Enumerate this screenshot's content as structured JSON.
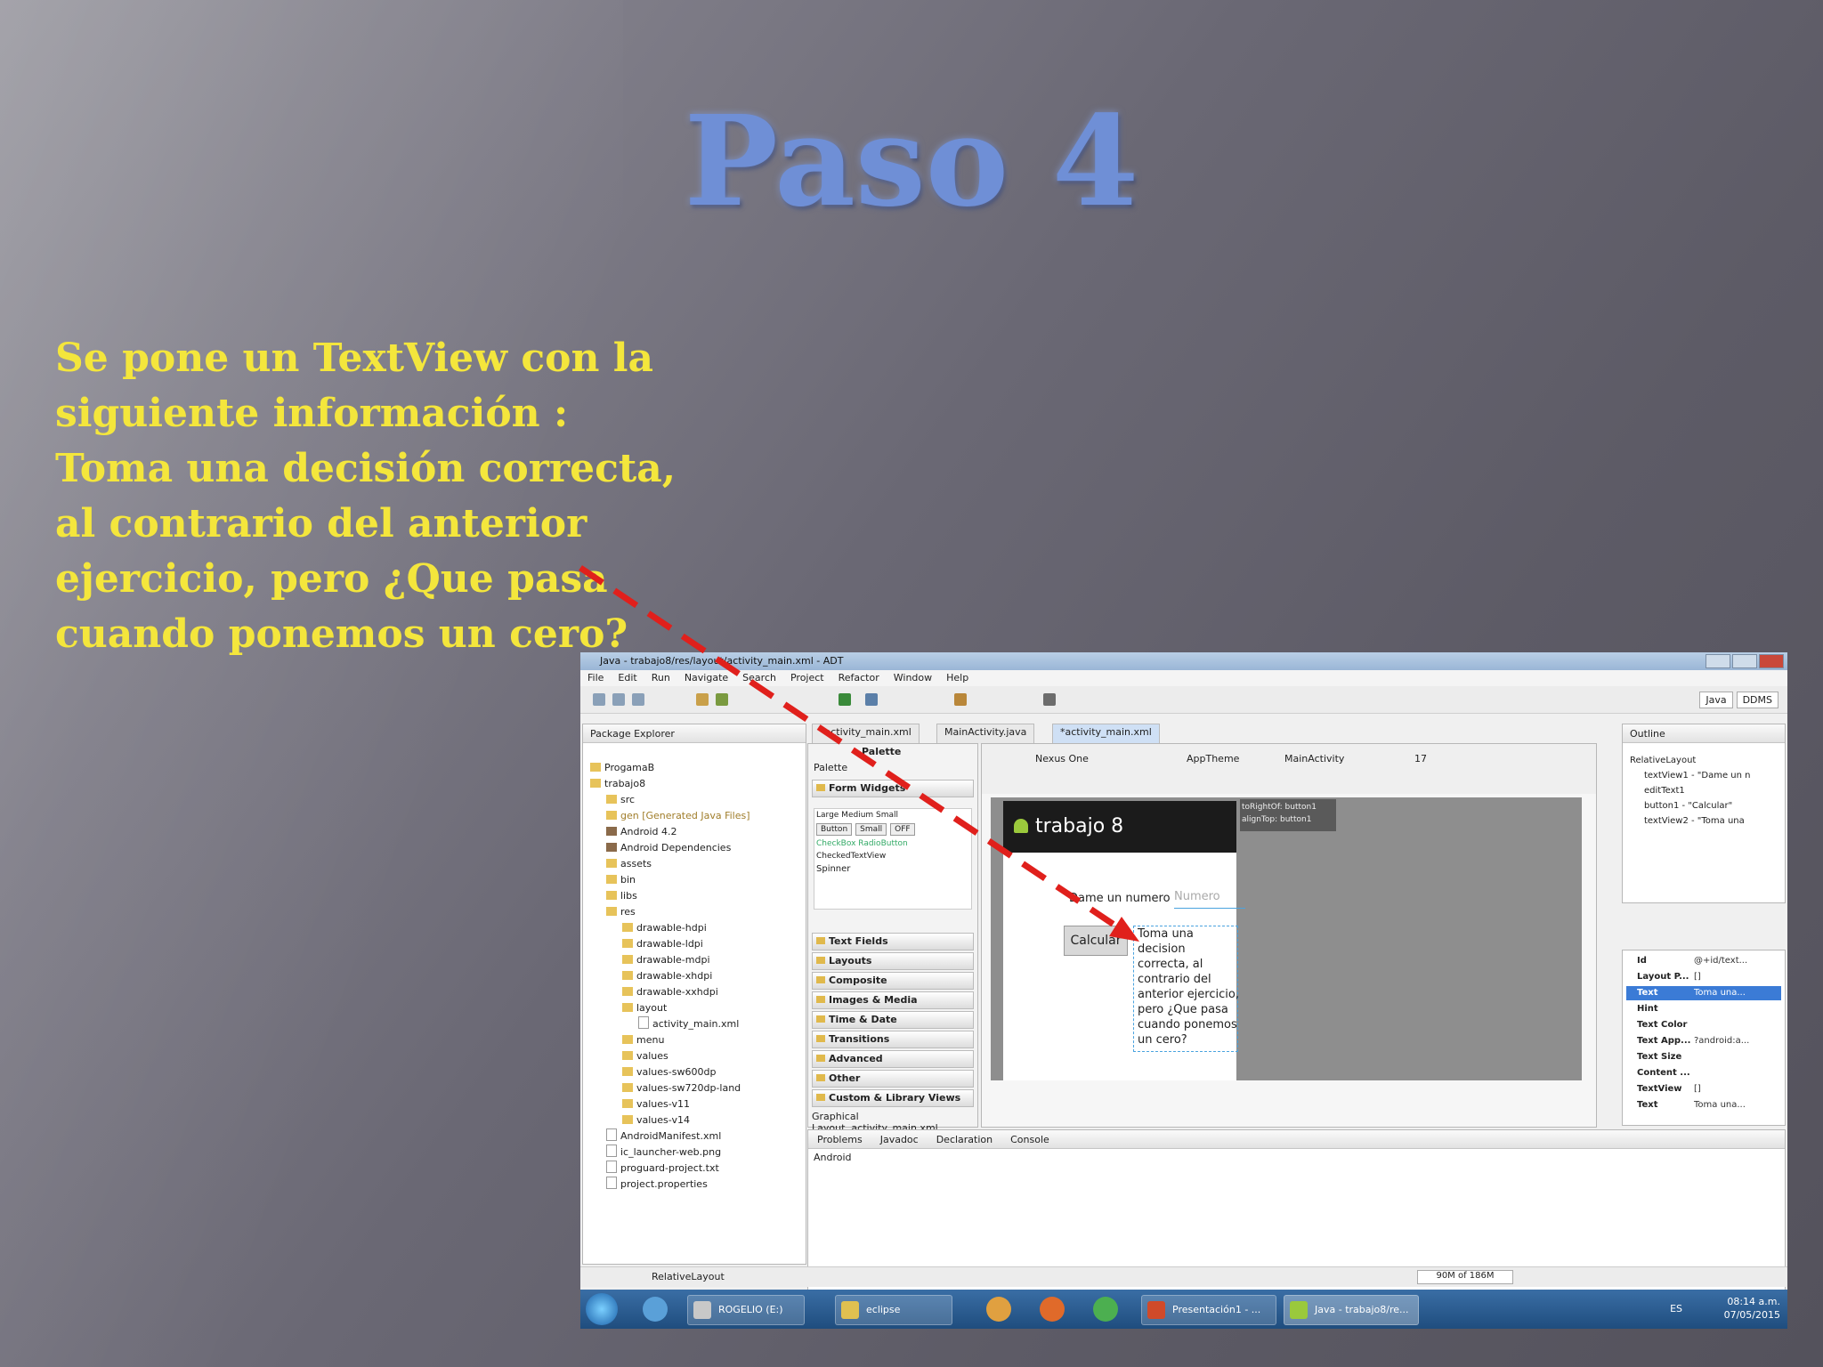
{
  "slide": {
    "title": "Paso 4",
    "body_lines": [
      "Se pone un TextView con la",
      "siguiente información :",
      "Toma una decisión correcta,",
      "al contrario del anterior",
      "ejercicio, pero ¿Que pasa",
      "cuando ponemos un cero?"
    ]
  },
  "colors": {
    "title": "#6f8fd6",
    "body_text": "#f4e63c",
    "arrow": "#e0201c"
  },
  "window": {
    "title": "Java - trabajo8/res/layout/activity_main.xml - ADT",
    "menu": [
      "File",
      "Edit",
      "Run",
      "Navigate",
      "Search",
      "Project",
      "Refactor",
      "Window",
      "Help"
    ],
    "perspectives": [
      "Java",
      "DDMS"
    ]
  },
  "package_explorer": {
    "tab": "Package Explorer",
    "items": [
      "ProgamaB",
      "trabajo8",
      "src",
      "gen [Generated Java Files]",
      "Android 4.2",
      "Android Dependencies",
      "assets",
      "bin",
      "libs",
      "res",
      "drawable-hdpi",
      "drawable-ldpi",
      "drawable-mdpi",
      "drawable-xhdpi",
      "drawable-xxhdpi",
      "layout",
      "activity_main.xml",
      "menu",
      "values",
      "values-sw600dp",
      "values-sw720dp-land",
      "values-v11",
      "values-v14",
      "AndroidManifest.xml",
      "ic_launcher-web.png",
      "proguard-project.txt",
      "project.properties"
    ]
  },
  "editor_tabs": [
    "*activity_main.xml",
    "MainActivity.java",
    "*activity_main.xml"
  ],
  "palette": {
    "header": "Palette",
    "section": "Palette",
    "form_widgets": "Form Widgets",
    "widget_row": "Large Medium Small",
    "widget_buttons": [
      "Button",
      "Small",
      "OFF"
    ],
    "checkbox_row": "CheckBox  RadioButton",
    "checked_textview": "CheckedTextView",
    "spinner": "Spinner",
    "categories": [
      "Text Fields",
      "Layouts",
      "Composite",
      "Images & Media",
      "Time & Date",
      "Transitions",
      "Advanced",
      "Other",
      "Custom & Library Views"
    ],
    "bottom_tabs": [
      "Graphical Layout",
      "activity_main.xml"
    ]
  },
  "canvas": {
    "device": "Nexus One",
    "theme": "AppTheme",
    "activity": "MainActivity",
    "api": "17",
    "app_title": "trabajo 8",
    "label": "Dame un numero",
    "hint": "Numero",
    "button": "Calcular",
    "textview_lines": [
      "Toma una",
      "decision",
      "correcta, al",
      "contrario del",
      "anterior ejercicio,",
      "pero ¿Que pasa",
      "cuando ponemos",
      "un cero?"
    ],
    "tooltip_lines": [
      "toRightOf: button1",
      "alignTop: button1"
    ]
  },
  "outline": {
    "tab": "Outline",
    "items": [
      "RelativeLayout",
      "textView1 - \"Dame un n",
      "editText1",
      "button1 - \"Calcular\"",
      "textView2 - \"Toma una"
    ]
  },
  "properties": [
    {
      "name": "Id",
      "value": "@+id/text..."
    },
    {
      "name": "Layout P...",
      "value": "[]"
    },
    {
      "name": "Text",
      "value": "Toma una..."
    },
    {
      "name": "Hint",
      "value": ""
    },
    {
      "name": "Text Color",
      "value": ""
    },
    {
      "name": "Text App...",
      "value": "?android:a..."
    },
    {
      "name": "Text Size",
      "value": ""
    },
    {
      "name": "Content ...",
      "value": ""
    },
    {
      "name": "TextView",
      "value": "[]"
    },
    {
      "name": "Text",
      "value": "Toma una..."
    }
  ],
  "bottom_panel": {
    "tabs": [
      "Problems",
      "Javadoc",
      "Declaration",
      "Console"
    ],
    "content": "Android"
  },
  "statusbar": {
    "left": "RelativeLayout",
    "memory": "90M of 186M"
  },
  "taskbar": {
    "items": [
      "ROGELIO (E:)",
      "eclipse",
      "Presentación1 - ...",
      "Java - trabajo8/re..."
    ],
    "lang": "ES",
    "time": "08:14 a.m.",
    "date": "07/05/2015"
  }
}
